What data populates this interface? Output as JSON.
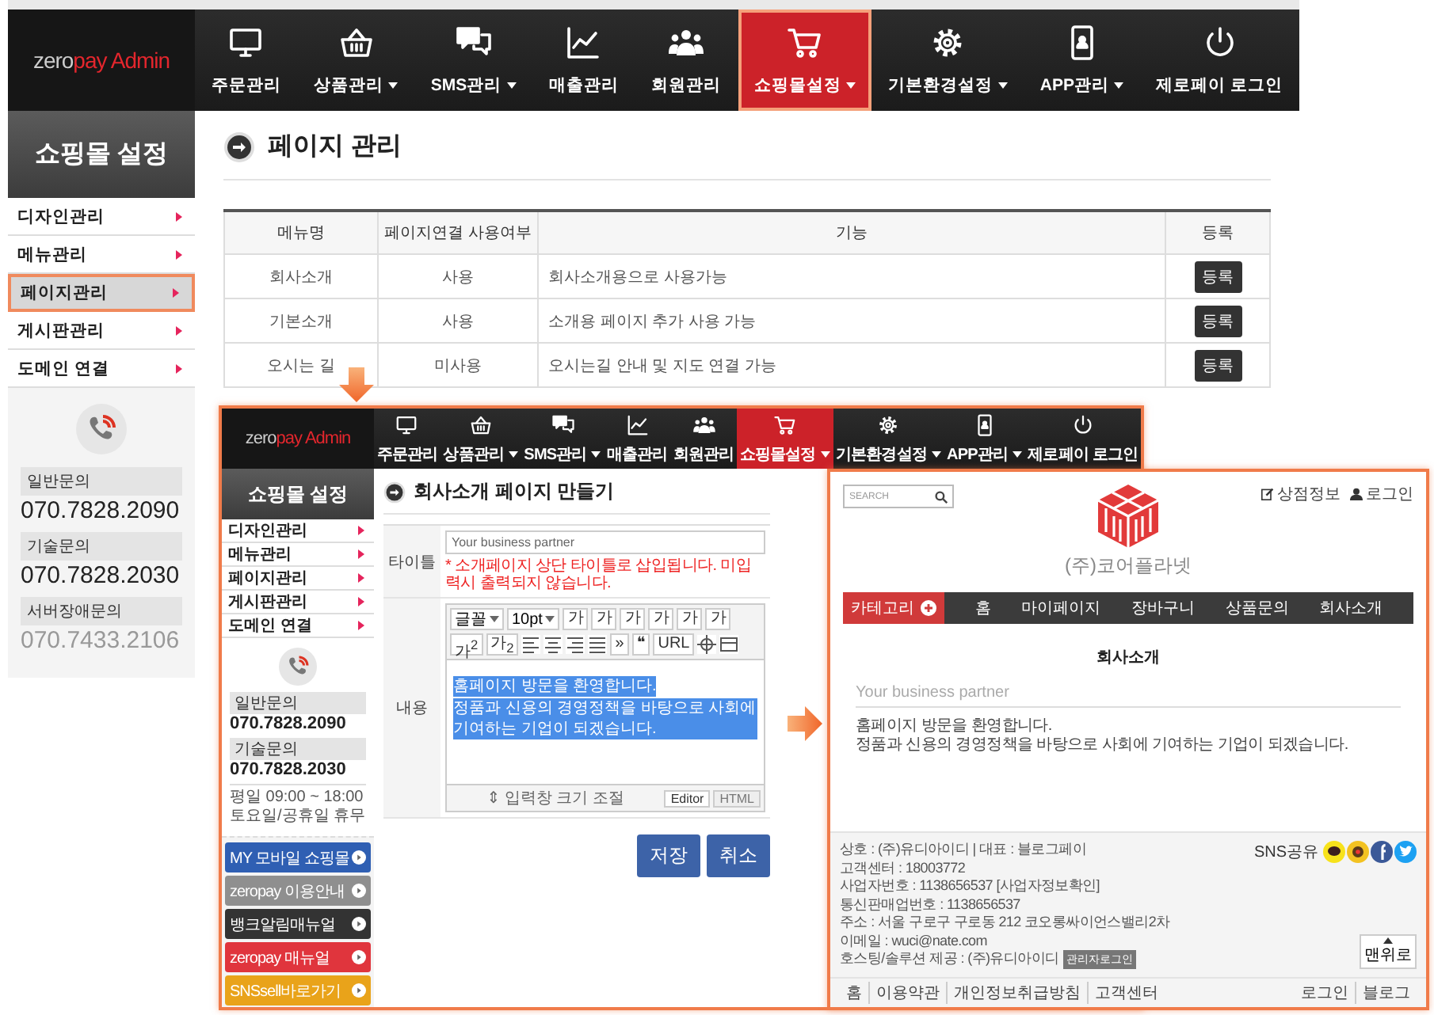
{
  "admin": {
    "logo": {
      "light": "zero",
      "accent": "pay Admin"
    },
    "nav": [
      {
        "label": "주문관리",
        "dropdown": false,
        "selected": false
      },
      {
        "label": "상품관리",
        "dropdown": true,
        "selected": false
      },
      {
        "label": "SMS관리",
        "dropdown": true,
        "selected": false
      },
      {
        "label": "매출관리",
        "dropdown": false,
        "selected": false
      },
      {
        "label": "회원관리",
        "dropdown": false,
        "selected": false
      },
      {
        "label": "쇼핑몰설정",
        "dropdown": true,
        "selected": true
      },
      {
        "label": "기본환경설정",
        "dropdown": true,
        "selected": false
      },
      {
        "label": "APP관리",
        "dropdown": true,
        "selected": false
      },
      {
        "label": "제로페이 로그인",
        "dropdown": false,
        "selected": false
      }
    ],
    "sidebar": {
      "title": "쇼핑몰 설정",
      "items": [
        {
          "label": "디자인관리",
          "selected": false
        },
        {
          "label": "메뉴관리",
          "selected": false
        },
        {
          "label": "페이지관리",
          "selected": true
        },
        {
          "label": "게시판관리",
          "selected": false
        },
        {
          "label": "도메인 연결",
          "selected": false
        }
      ]
    },
    "contacts": [
      {
        "label": "일반문의",
        "number": "070.7828.2090"
      },
      {
        "label": "기술문의",
        "number": "070.7828.2030"
      },
      {
        "label": "서버장애문의",
        "number": "070.7433.2106"
      }
    ],
    "page_title": "페이지 관리",
    "table": {
      "columns": [
        "메뉴명",
        "페이지연결 사용여부",
        "기능",
        "등록"
      ],
      "rows": [
        {
          "menu": "회사소개",
          "usage": "사용",
          "feature": "회사소개용으로 사용가능",
          "button": "등록"
        },
        {
          "menu": "기본소개",
          "usage": "사용",
          "feature": "소개용 페이지 추가 사용 가능",
          "button": "등록"
        },
        {
          "menu": "오시는 길",
          "usage": "미사용",
          "feature": "오시는길 안내 및 지도 연결 가능",
          "button": "등록"
        }
      ]
    }
  },
  "editor_window": {
    "logo": {
      "light": "zero",
      "accent": "pay Admin"
    },
    "nav": [
      {
        "label": "주문관리",
        "dropdown": false,
        "selected": false
      },
      {
        "label": "상품관리",
        "dropdown": true,
        "selected": false
      },
      {
        "label": "SMS관리",
        "dropdown": true,
        "selected": false
      },
      {
        "label": "매출관리",
        "dropdown": false,
        "selected": false
      },
      {
        "label": "회원관리",
        "dropdown": false,
        "selected": false
      },
      {
        "label": "쇼핑몰설정",
        "dropdown": true,
        "selected": true
      },
      {
        "label": "기본환경설정",
        "dropdown": true,
        "selected": false
      },
      {
        "label": "APP관리",
        "dropdown": true,
        "selected": false
      },
      {
        "label": "제로페이 로그인",
        "dropdown": false,
        "selected": false
      }
    ],
    "sidebar": {
      "title": "쇼핑몰 설정",
      "items": [
        {
          "label": "디자인관리",
          "selected": false
        },
        {
          "label": "메뉴관리",
          "selected": false
        },
        {
          "label": "페이지관리",
          "selected": false
        },
        {
          "label": "게시판관리",
          "selected": false
        },
        {
          "label": "도메인 연결",
          "selected": false
        }
      ]
    },
    "contacts": [
      {
        "label": "일반문의",
        "number": "070.7828.2090"
      },
      {
        "label": "기술문의",
        "number": "070.7828.2030"
      }
    ],
    "hours": [
      "평일 09:00 ~ 18:00",
      "토요일/공휴일 휴무"
    ],
    "quick_links": [
      {
        "label": "MY 모바일 쇼핑몰",
        "color": "#2f5fb3"
      },
      {
        "label": "zeropay 이용안내",
        "color": "#8f8f8f"
      },
      {
        "label": "뱅크알림매뉴얼",
        "color": "#333333"
      },
      {
        "label": "zeropay 매뉴얼",
        "color": "#e0353d"
      },
      {
        "label": "SNSsell바로가기",
        "color": "#e9a31a"
      }
    ],
    "page_title": "회사소개 페이지 만들기",
    "form": {
      "title_label": "타이틀",
      "title_value": "Your business partner",
      "note": "* 소개페이지 상단 타이틀로 삽입됩니다. 미입력시 출력되지 않습니다.",
      "content_label": "내용",
      "toolbar": {
        "font": "글꼴",
        "size": "10pt",
        "format": [
          "가",
          "가",
          "가",
          "가",
          "가",
          "가",
          "가$^{2}$",
          "가$_{2}$"
        ],
        "extras": [
          "»",
          "❝",
          "URL"
        ]
      },
      "content_lines": [
        {
          "text": "홈페이지 방문을 환영합니다.",
          "selected": true
        },
        {
          "text": "정품과 신용의 경영정책을 바탕으로 사회에 기여하는 기업이 되겠습니다.",
          "selected": true
        }
      ],
      "resize_hint": "⇕ 입력창 크기 조절",
      "modes": [
        {
          "label": "Editor",
          "selected": true
        },
        {
          "label": "HTML",
          "selected": false
        }
      ]
    },
    "buttons": [
      "저장",
      "취소"
    ]
  },
  "preview_window": {
    "search_placeholder": "SEARCH",
    "company": "(주)코어플라넷",
    "top_links": [
      "상점정보",
      "로그인"
    ],
    "category": "카테고리",
    "menu": [
      "홈",
      "마이페이지",
      "장바구니",
      "상품문의",
      "회사소개"
    ],
    "heading": "회사소개",
    "subtitle": "Your business partner",
    "body": [
      "홈페이지 방문을 환영합니다.",
      "정품과 신용의 경영정책을 바탕으로 사회에 기여하는 기업이 되겠습니다."
    ],
    "footer_info": [
      "상호 : (주)유디아이디 | 대표 : 블로그페이",
      "고객센터 : 18003772",
      "사업자번호 : 1138656537 [사업자정보확인]",
      "통신판매업번호 : 1138656537",
      "주소 : 서울 구로구 구로동 212 코오롱싸이언스밸리2차",
      "이메일 : wuci@nate.com"
    ],
    "hosting": "호스팅/솔루션 제공 : (주)유디아이디",
    "admin_login": "관리자로그인",
    "sns_label": "SNS공유",
    "top_button": "맨위로",
    "bottom_links_left": [
      "홈",
      "이용약관",
      "개인정보취급방침",
      "고객센터"
    ],
    "bottom_links_right": [
      "로그인",
      "블로그"
    ]
  }
}
